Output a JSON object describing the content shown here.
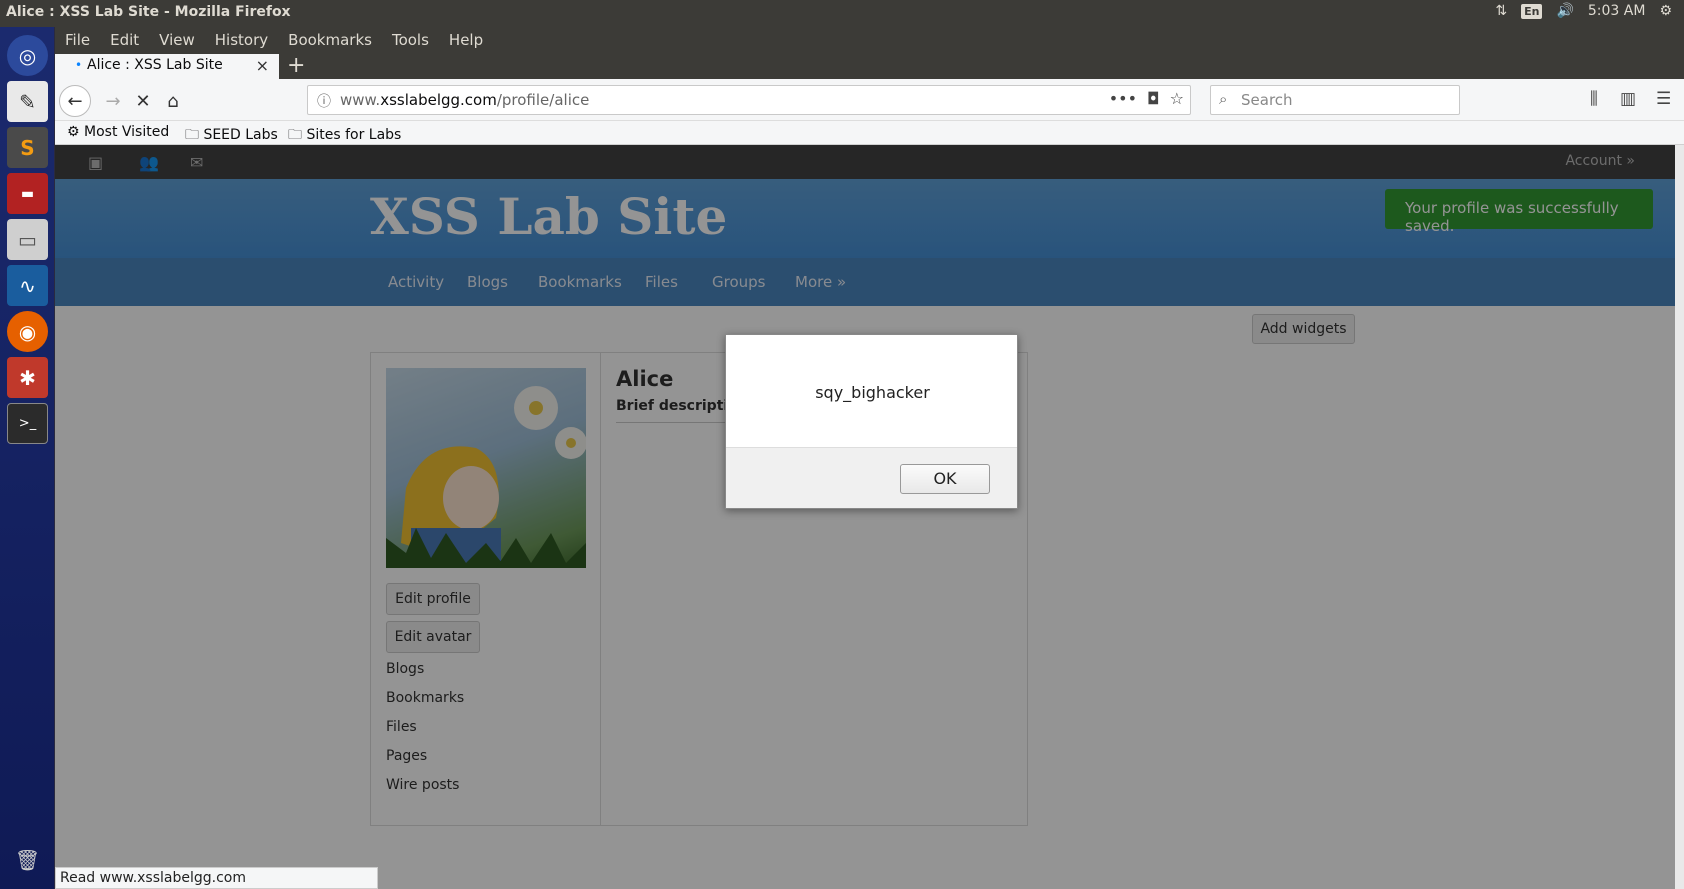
{
  "system": {
    "window_title": "Alice : XSS Lab Site - Mozilla Firefox",
    "lang": "En",
    "clock": "5:03 AM"
  },
  "launcher": {
    "items": [
      "ubuntu-dash-icon",
      "text-editor-icon",
      "sublime-text-icon",
      "terminal-red-icon",
      "files-icon",
      "wireshark-icon",
      "firefox-icon",
      "settings-icon",
      "terminal-icon",
      "trash-icon"
    ]
  },
  "menubar": {
    "items": [
      "File",
      "Edit",
      "View",
      "History",
      "Bookmarks",
      "Tools",
      "Help"
    ]
  },
  "tab": {
    "title": "Alice : XSS Lab Site",
    "close": "×",
    "new_tab": "+"
  },
  "navbar": {
    "url_prefix": "www.",
    "url_host": "xsslabelgg.com",
    "url_path": "/profile/alice",
    "url_actions": "•••",
    "search_placeholder": "Search"
  },
  "bookmarks_bar": {
    "items": [
      "Most Visited",
      "SEED Labs",
      "Sites for Labs"
    ]
  },
  "site": {
    "account": "Account »",
    "title": "XSS Lab Site",
    "success_message": "Your profile was successfully saved.",
    "nav": [
      "Activity",
      "Blogs",
      "Bookmarks",
      "Files",
      "Groups",
      "More »"
    ],
    "add_widgets": "Add widgets",
    "profile_name": "Alice",
    "brief_description": "Brief description:",
    "buttons": {
      "edit_profile": "Edit profile",
      "edit_avatar": "Edit avatar"
    },
    "side_links": [
      "Blogs",
      "Bookmarks",
      "Files",
      "Pages",
      "Wire posts"
    ]
  },
  "alert": {
    "message": "sqy_bighacker",
    "ok": "OK"
  },
  "statusbar": {
    "text": "Read www.xsslabelgg.com"
  },
  "colors": {
    "header_blue": "#4690d6",
    "nav_blue": "#4b87bf",
    "success_green": "#339933",
    "launcher_blue": "#1b2a6e"
  }
}
